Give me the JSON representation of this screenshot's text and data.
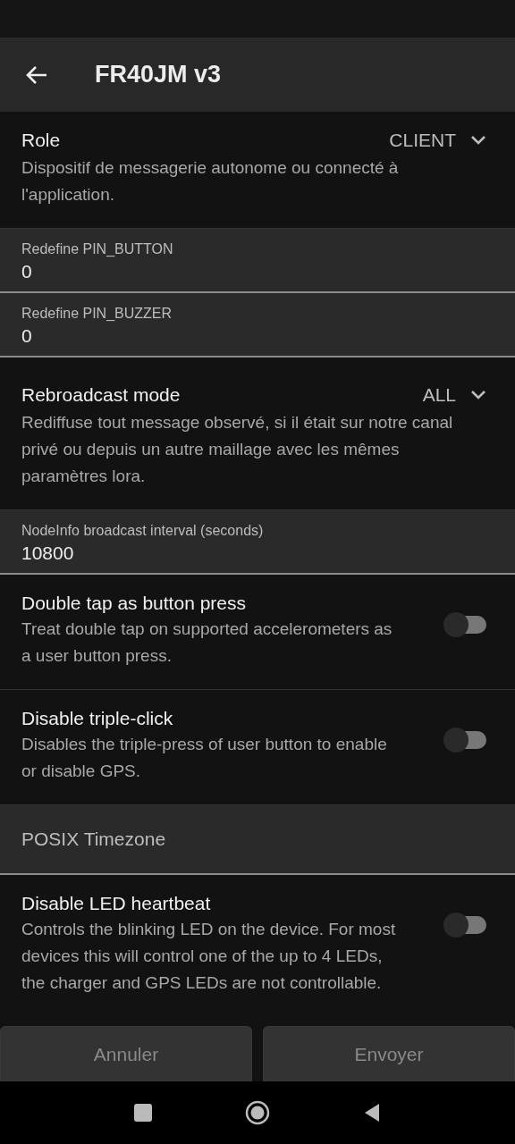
{
  "app_bar": {
    "title": "FR40JM v3"
  },
  "settings": [
    {
      "kind": "dropdown",
      "title": "Role",
      "value": "CLIENT",
      "description": "Dispositif de messagerie autonome ou connecté à l'application."
    },
    {
      "kind": "text_field",
      "label": "Redefine PIN_BUTTON",
      "value": "0"
    },
    {
      "kind": "text_field",
      "label": "Redefine PIN_BUZZER",
      "value": "0"
    },
    {
      "kind": "dropdown",
      "title": "Rebroadcast mode",
      "value": "ALL",
      "description": "Rediffuse tout message observé, si il était sur notre canal privé ou depuis un autre maillage avec les mêmes paramètres lora."
    },
    {
      "kind": "text_field",
      "label": "NodeInfo broadcast interval (seconds)",
      "value": "10800"
    },
    {
      "kind": "switch",
      "title": "Double tap as button press",
      "description": "Treat double tap on supported accelerometers as a user button press.",
      "checked": false
    },
    {
      "kind": "switch",
      "title": "Disable triple-click",
      "description": "Disables the triple-press of user button to enable or disable GPS.",
      "checked": false
    },
    {
      "kind": "empty_field",
      "placeholder": "POSIX Timezone"
    },
    {
      "kind": "switch",
      "title": "Disable LED heartbeat",
      "description": "Controls the blinking LED on the device. For most devices this will control one of the up to 4 LEDs, the charger and GPS LEDs are not controllable.",
      "checked": false
    }
  ],
  "buttons": [
    {
      "label": "Annuler",
      "disabled": true
    },
    {
      "label": "Envoyer",
      "disabled": true
    }
  ]
}
